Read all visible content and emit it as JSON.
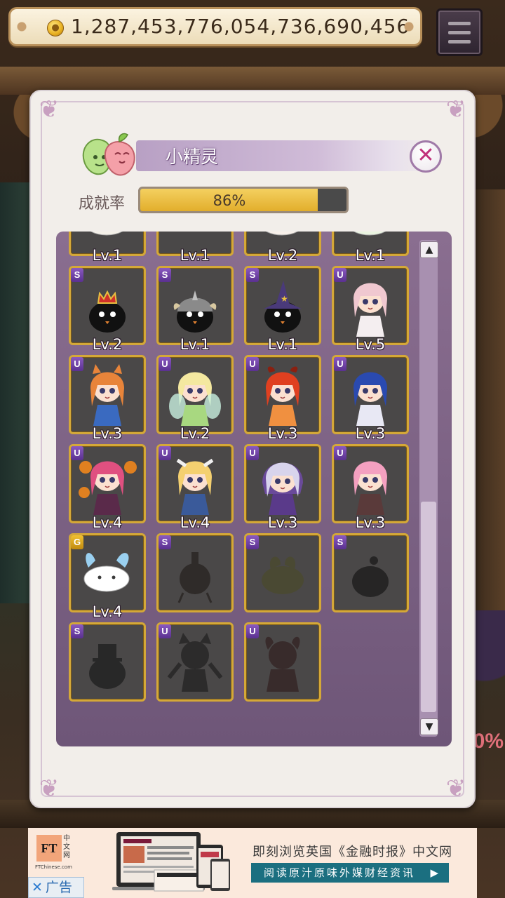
{
  "header": {
    "coin_icon": "gold-coin-icon",
    "coin_value": "1,287,453,776,054,736,690,456",
    "menu_icon": "hamburger-menu-icon"
  },
  "dialog": {
    "title": "小精灵",
    "close_icon": "close-x-icon",
    "completion_label": "成就率",
    "completion_value": "86%",
    "completion_fraction": 0.86,
    "scroll_up_icon": "▲",
    "scroll_down_icon": "▼"
  },
  "cards": [
    {
      "rank": "",
      "level": "Lv.1",
      "kind": "bunny-blue",
      "locked": false
    },
    {
      "rank": "",
      "level": "Lv.1",
      "kind": "fish-purple",
      "locked": false
    },
    {
      "rank": "",
      "level": "Lv.2",
      "kind": "bunny-red",
      "locked": false
    },
    {
      "rank": "",
      "level": "Lv.1",
      "kind": "bunny-green",
      "locked": false
    },
    {
      "rank": "S",
      "level": "Lv.2",
      "kind": "blob-crown",
      "locked": false
    },
    {
      "rank": "S",
      "level": "Lv.1",
      "kind": "blob-helmet",
      "locked": false
    },
    {
      "rank": "S",
      "level": "Lv.1",
      "kind": "blob-witch",
      "locked": false
    },
    {
      "rank": "U",
      "level": "Lv.5",
      "kind": "girl-pink",
      "locked": false
    },
    {
      "rank": "U",
      "level": "Lv.3",
      "kind": "girl-fox",
      "locked": false
    },
    {
      "rank": "U",
      "level": "Lv.2",
      "kind": "girl-fairy",
      "locked": false
    },
    {
      "rank": "U",
      "level": "Lv.3",
      "kind": "girl-fire",
      "locked": false
    },
    {
      "rank": "U",
      "level": "Lv.3",
      "kind": "girl-blue",
      "locked": false
    },
    {
      "rank": "U",
      "level": "Lv.4",
      "kind": "girl-pumpkin",
      "locked": false
    },
    {
      "rank": "U",
      "level": "Lv.4",
      "kind": "girl-valkyrie",
      "locked": false
    },
    {
      "rank": "U",
      "level": "Lv.3",
      "kind": "girl-hood",
      "locked": false
    },
    {
      "rank": "U",
      "level": "Lv.3",
      "kind": "girl-pinkhair",
      "locked": false
    },
    {
      "rank": "G",
      "level": "Lv.4",
      "kind": "bunny-white",
      "locked": false
    },
    {
      "rank": "S",
      "level": "",
      "kind": "flask-silhouette",
      "locked": true
    },
    {
      "rank": "S",
      "level": "",
      "kind": "beetle-silhouette",
      "locked": true
    },
    {
      "rank": "S",
      "level": "",
      "kind": "blob-silhouette",
      "locked": true
    },
    {
      "rank": "S",
      "level": "",
      "kind": "tophat-silhouette",
      "locked": true
    },
    {
      "rank": "U",
      "level": "",
      "kind": "catgirl-silhouette",
      "locked": true
    },
    {
      "rank": "U",
      "level": "",
      "kind": "demon-silhouette",
      "locked": true
    }
  ],
  "ad": {
    "logo_text": "FT",
    "logo_cn": "中文网",
    "logo_domain": "FTChinese.com",
    "close_icon": "✕",
    "close_label": "广告",
    "image_icon": "newspaper-devices-icon",
    "headline": "即刻浏览英国《金融时报》中文网",
    "cta": "阅读原汁原味外媒财经资讯",
    "cta_icon": "▶"
  },
  "background": {
    "partial_text": "0%"
  }
}
